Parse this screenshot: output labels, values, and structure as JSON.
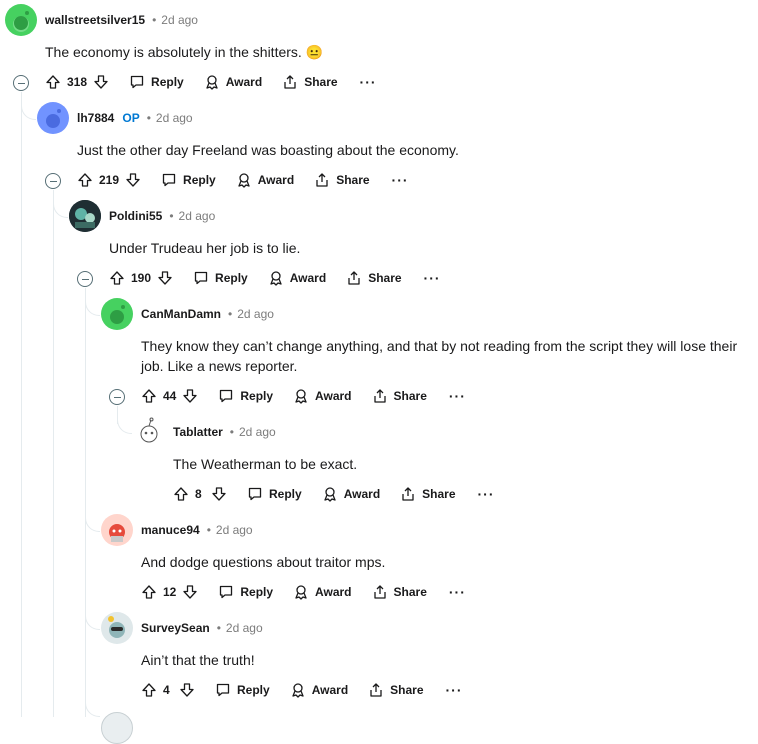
{
  "comments": [
    {
      "username": "wallstreetsilver15",
      "op": "",
      "time": "2d ago",
      "text": "The economy is absolutely in the shitters. 😐",
      "score": "318"
    },
    {
      "username": "lh7884",
      "op": "OP",
      "time": "2d ago",
      "text": "Just the other day Freeland was boasting about the economy.",
      "score": "219"
    },
    {
      "username": "Poldini55",
      "op": "",
      "time": "2d ago",
      "text": "Under Trudeau her job is to lie.",
      "score": "190"
    },
    {
      "username": "CanManDamn",
      "op": "",
      "time": "2d ago",
      "text": "They know they can’t change anything, and that by not reading from the script they will lose their job. Like a news reporter.",
      "score": "44"
    },
    {
      "username": "Tablatter",
      "op": "",
      "time": "2d ago",
      "text": "The Weatherman to be exact.",
      "score": "8"
    },
    {
      "username": "manuce94",
      "op": "",
      "time": "2d ago",
      "text": "And dodge questions about traitor mps.",
      "score": "12"
    },
    {
      "username": "SurveySean",
      "op": "",
      "time": "2d ago",
      "text": "Ain’t that the truth!",
      "score": "4"
    }
  ],
  "actions": {
    "reply": "Reply",
    "award": "Award",
    "share": "Share",
    "more": "···"
  },
  "meta": {
    "separator": "•"
  },
  "colors": {
    "green_avatar": "#46d160",
    "blue_avatar": "#7193ff",
    "op_badge": "#0079d3",
    "thread_line": "#e5ebee"
  },
  "icons": [
    "upvote-icon",
    "downvote-icon",
    "reply-icon",
    "award-icon",
    "share-icon",
    "collapse-icon"
  ]
}
